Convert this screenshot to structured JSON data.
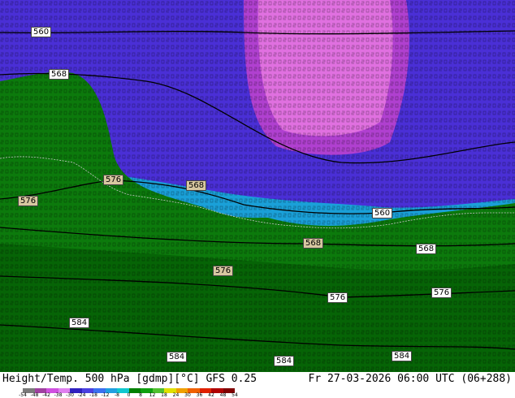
{
  "map": {
    "contour_labels": [
      {
        "text": "560",
        "kind": "sea"
      },
      {
        "text": "568",
        "kind": "sea"
      },
      {
        "text": "576",
        "kind": "land"
      },
      {
        "text": "568",
        "kind": "land"
      },
      {
        "text": "576",
        "kind": "land"
      },
      {
        "text": "560",
        "kind": "sea"
      },
      {
        "text": "568",
        "kind": "land"
      },
      {
        "text": "568",
        "kind": "sea"
      },
      {
        "text": "576",
        "kind": "land"
      },
      {
        "text": "576",
        "kind": "sea"
      },
      {
        "text": "576",
        "kind": "sea"
      },
      {
        "text": "584",
        "kind": "sea"
      },
      {
        "text": "584",
        "kind": "sea"
      },
      {
        "text": "584",
        "kind": "sea"
      },
      {
        "text": "584",
        "kind": "sea"
      }
    ],
    "colors": {
      "very_cold": "#e070e0",
      "cold_core": "#c040d0",
      "cold": "#4a2fd6",
      "cool": "#3a6af0",
      "mild_sea": "#1aa0d8",
      "land": "#0c7a0c",
      "land_dark": "#066406"
    }
  },
  "footer": {
    "title": "Height/Temp. 500 hPa [gdmp][°C] GFS 0.25",
    "date": "Fr 27-03-2026 06:00 UTC (06+288)"
  },
  "colorbar": {
    "ticks": [
      "-54",
      "-48",
      "-42",
      "-38",
      "-30",
      "-24",
      "-18",
      "-12",
      "-8",
      "0",
      "8",
      "12",
      "18",
      "24",
      "30",
      "36",
      "42",
      "48",
      "54"
    ],
    "colors": [
      "#7a7a7a",
      "#a040a0",
      "#d050e0",
      "#e080f0",
      "#3020c0",
      "#4a40e0",
      "#3a70f0",
      "#20a0e0",
      "#10c8d0",
      "#008000",
      "#10a010",
      "#50c030",
      "#e0e000",
      "#f0a000",
      "#f06000",
      "#e02000",
      "#b00000",
      "#800000"
    ]
  }
}
